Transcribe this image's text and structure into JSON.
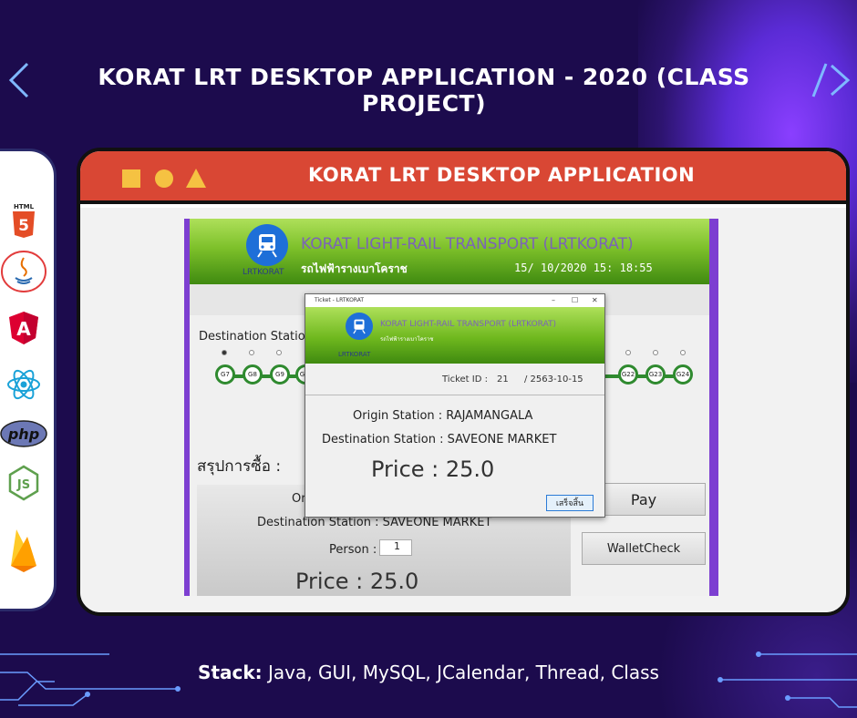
{
  "slide": {
    "title": "KORAT LRT DESKTOP APPLICATION - 2020 (CLASS PROJECT)",
    "stack_label": "Stack:",
    "stack_value": " Java, GUI, MySQL, JCalendar, Thread, Class"
  },
  "tech_icons": [
    "html5-icon",
    "java-icon",
    "angular-icon",
    "react-icon",
    "php-icon",
    "nodejs-icon",
    "firebase-icon"
  ],
  "tech_labels": {
    "html": "HTML",
    "php": "php",
    "js": "JS"
  },
  "window": {
    "title": "KORAT LRT DESKTOP APPLICATION"
  },
  "app": {
    "name": "KORAT LIGHT-RAIL TRANSPORT (LRTKORAT)",
    "name_thai": "รถไฟฟ้ารางเบาโคราช",
    "logo_text": "LRTKORAT",
    "datetime": "15/ 10/2020  15: 18:55",
    "destination_station_label": "Destination Statio",
    "stations_left": [
      "G7",
      "G8",
      "G9",
      "G"
    ],
    "stations_right": [
      "G22",
      "G23",
      "G24"
    ],
    "summary_label": "สรุปการซื้อ :",
    "summary_origin": "Ori",
    "summary_destination": "Destination Station :  SAVEONE MARKET",
    "person_label": "Person :",
    "person_value": "1",
    "summary_price": "Price :  25.0",
    "pay_button": "Pay",
    "wallet_button": "WalletCheck"
  },
  "dialog": {
    "title": "Ticket - LRTKORAT",
    "min": "–",
    "max": "☐",
    "close": "✕",
    "header_name": "KORAT LIGHT-RAIL TRANSPORT (LRTKORAT)",
    "header_thai": "รถไฟฟ้ารางเบาโคราช",
    "logo_text": "LRTKORAT",
    "ticket_id_label": "Ticket ID :",
    "ticket_id_value": "21",
    "ticket_date": "/ 2563-10-15",
    "origin": "Origin Station :  RAJAMANGALA",
    "destination": "Destination Station :  SAVEONE MARKET",
    "price": "Price :  25.0",
    "ok_button": "เสร็จสิ้น"
  },
  "colors": {
    "background": "#1c0b4d",
    "window_bar": "#d94734",
    "accent_yellow": "#f5c242",
    "app_green": "#7dc02a",
    "nav_arrow": "#7fb8ff"
  }
}
